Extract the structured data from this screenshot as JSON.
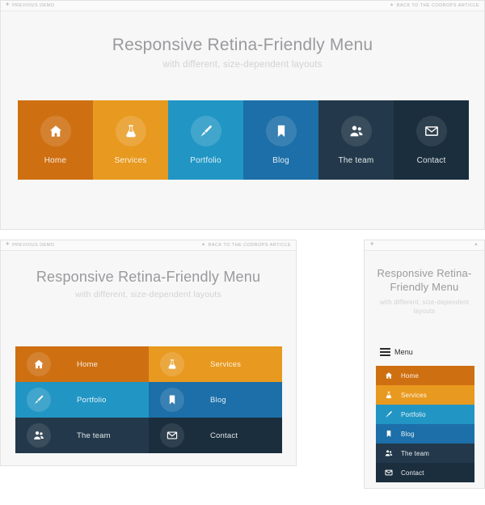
{
  "topbar": {
    "prev_label": "PREVIOUS DEMO",
    "prev_icon": "arrow-left-icon",
    "back_label": "BACK TO THE CODROPS ARTICLE",
    "back_icon": "arrow-up-icon"
  },
  "hero": {
    "title": "Responsive Retina-Friendly Menu",
    "subtitle": "with different, size-dependent layouts"
  },
  "mobile": {
    "toggle_label": "Menu",
    "toggle_icon": "hamburger-icon"
  },
  "colors": {
    "page_background": "#ffffff",
    "panel_background": "#f7f7f7",
    "panel_border": "#e3e3e3",
    "topbar_background": "#fafafa",
    "title_color": "#9a9a9e",
    "subtitle_color": "#d2d2d4",
    "toggle_color": "#2b2b2b"
  },
  "menu": {
    "items": [
      {
        "label": "Home",
        "icon": "home-icon",
        "color": "#ce7012",
        "icon_circle": "rgba(255,255,255,0.13)"
      },
      {
        "label": "Services",
        "icon": "flask-icon",
        "color": "#e8991f",
        "icon_circle": "rgba(255,255,255,0.15)"
      },
      {
        "label": "Portfolio",
        "icon": "brush-icon",
        "color": "#2196c4",
        "icon_circle": "rgba(255,255,255,0.15)"
      },
      {
        "label": "Blog",
        "icon": "bookmark-icon",
        "color": "#1c6fa8",
        "icon_circle": "rgba(255,255,255,0.13)"
      },
      {
        "label": "The team",
        "icon": "users-icon",
        "color": "#23394b",
        "icon_circle": "rgba(255,255,255,0.10)"
      },
      {
        "label": "Contact",
        "icon": "envelope-icon",
        "color": "#1b2e3d",
        "icon_circle": "rgba(255,255,255,0.09)"
      }
    ]
  },
  "panels": [
    {
      "name": "desktop",
      "layout": "single-row-six-columns"
    },
    {
      "name": "tablet",
      "layout": "two-column-grid"
    },
    {
      "name": "mobile",
      "layout": "vertical-list-with-toggle"
    }
  ]
}
